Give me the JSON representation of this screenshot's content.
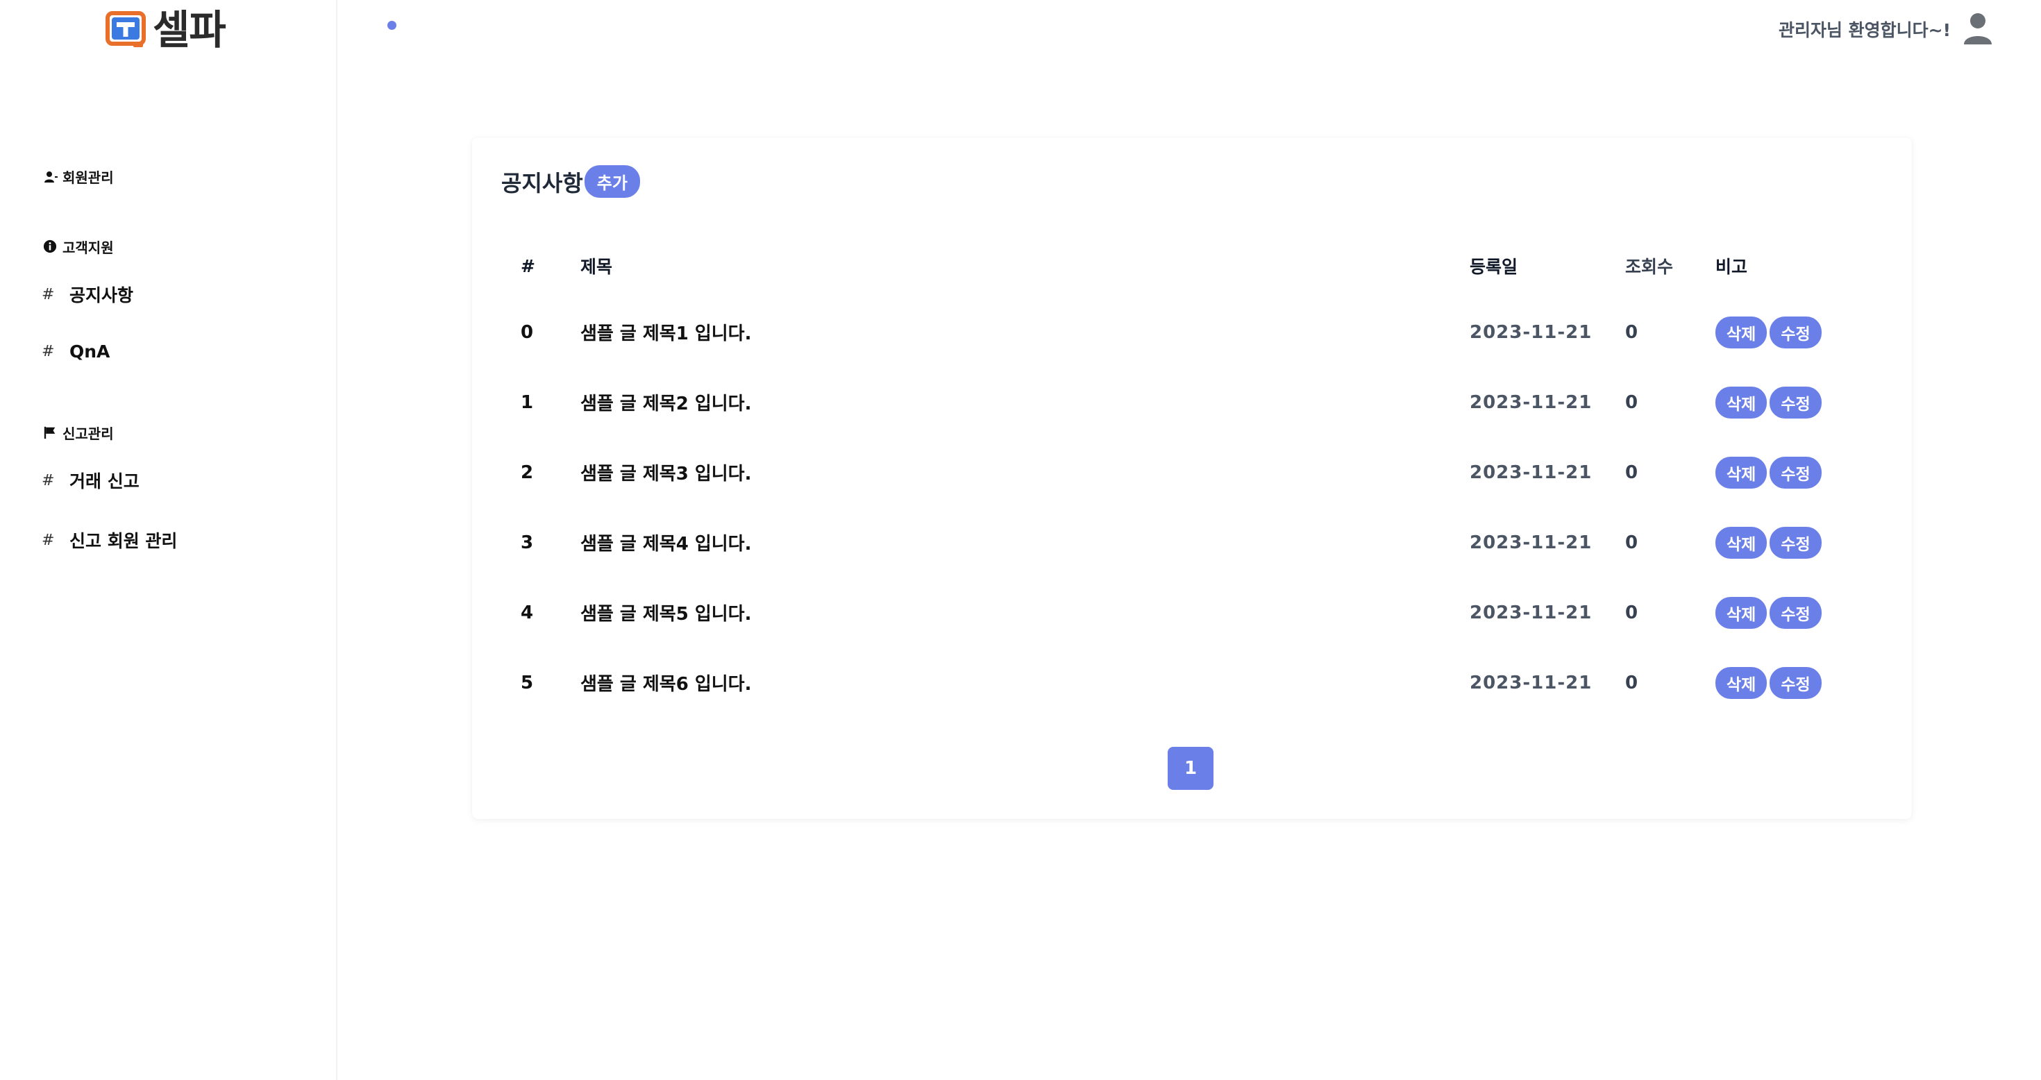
{
  "brand": {
    "name": "셀파",
    "accent": "#6b7fe8",
    "logo_orange": "#e8702a",
    "logo_blue": "#3b7ae0"
  },
  "header": {
    "welcome": "관리자님 환영합니다~!",
    "user_icon": "user-icon"
  },
  "sidebar": {
    "sections": [
      {
        "icon": "user-icon",
        "label": "회원관리",
        "items": []
      },
      {
        "icon": "info-icon",
        "label": "고객지원",
        "items": [
          {
            "hash": "#",
            "label": "공지사항"
          },
          {
            "hash": "#",
            "label": "QnA"
          }
        ]
      },
      {
        "icon": "flag-icon",
        "label": "신고관리",
        "items": [
          {
            "hash": "#",
            "label": "거래 신고"
          },
          {
            "hash": "#",
            "label": "신고 회원 관리"
          }
        ]
      }
    ]
  },
  "notice": {
    "title": "공지사항",
    "add_label": "추가",
    "columns": [
      "#",
      "제목",
      "등록일",
      "조회수",
      "비고"
    ],
    "rows": [
      {
        "num": "0",
        "title": "샘플 글 제목1 입니다.",
        "date": "2023-11-21",
        "views": "0"
      },
      {
        "num": "1",
        "title": "샘플 글 제목2 입니다.",
        "date": "2023-11-21",
        "views": "0"
      },
      {
        "num": "2",
        "title": "샘플 글 제목3 입니다.",
        "date": "2023-11-21",
        "views": "0"
      },
      {
        "num": "3",
        "title": "샘플 글 제목4 입니다.",
        "date": "2023-11-21",
        "views": "0"
      },
      {
        "num": "4",
        "title": "샘플 글 제목5 입니다.",
        "date": "2023-11-21",
        "views": "0"
      },
      {
        "num": "5",
        "title": "샘플 글 제목6 입니다.",
        "date": "2023-11-21",
        "views": "0"
      }
    ],
    "delete_label": "삭제",
    "edit_label": "수정",
    "page": "1"
  }
}
